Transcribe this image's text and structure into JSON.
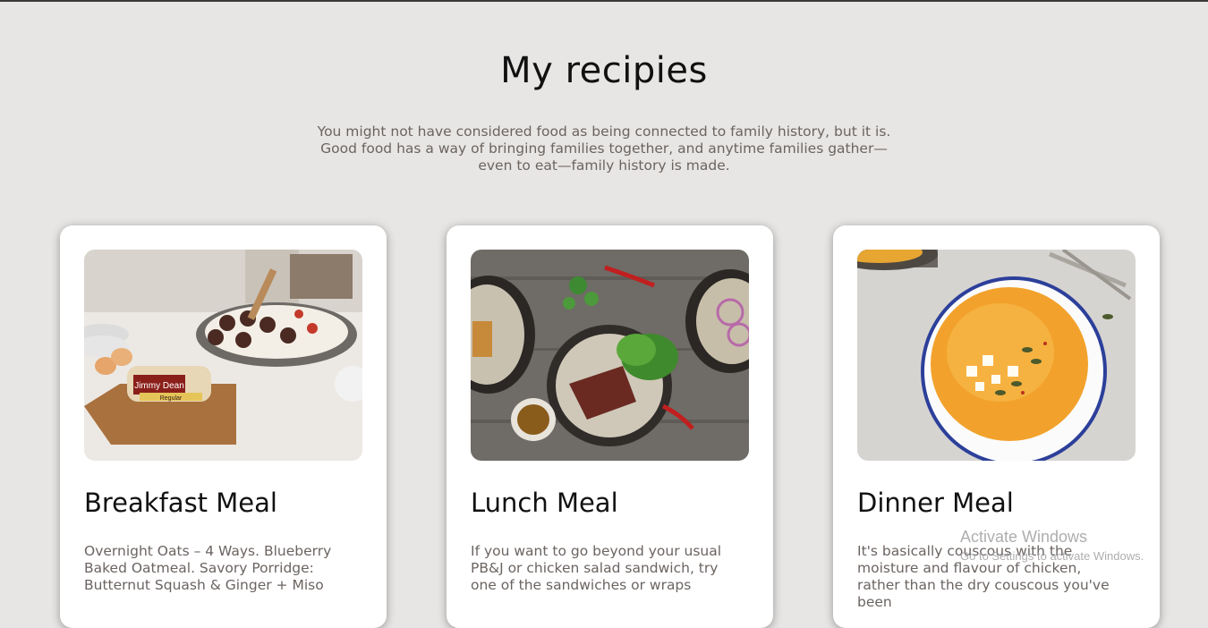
{
  "header": {
    "title": "My recipies",
    "intro": "You might not have considered food as being connected to family history, but it is. Good food has a way of bringing families together, and anytime families gather—even to eat—family history is made."
  },
  "cards": [
    {
      "title": "Breakfast Meal",
      "description": "Overnight Oats – 4 Ways. Blueberry Baked Oatmeal. Savory Porridge: Butternut Squash & Ginger + Miso",
      "image_label_brand": "Jimmy Dean",
      "image_label_variant": "Regular"
    },
    {
      "title": "Lunch Meal",
      "description": "If you want to go beyond your usual PB&J or chicken salad sandwich, try one of the sandwiches or wraps"
    },
    {
      "title": "Dinner Meal",
      "description": "It's basically couscous with the moisture and flavour of chicken, rather than the dry couscous you've been"
    }
  ],
  "watermark": {
    "line1": "Activate Windows",
    "line2": "Go to Settings to activate Windows."
  },
  "colors": {
    "background": "#e8e6e4",
    "card": "#ffffff",
    "heading": "#111111",
    "body_text": "#6b6461"
  }
}
